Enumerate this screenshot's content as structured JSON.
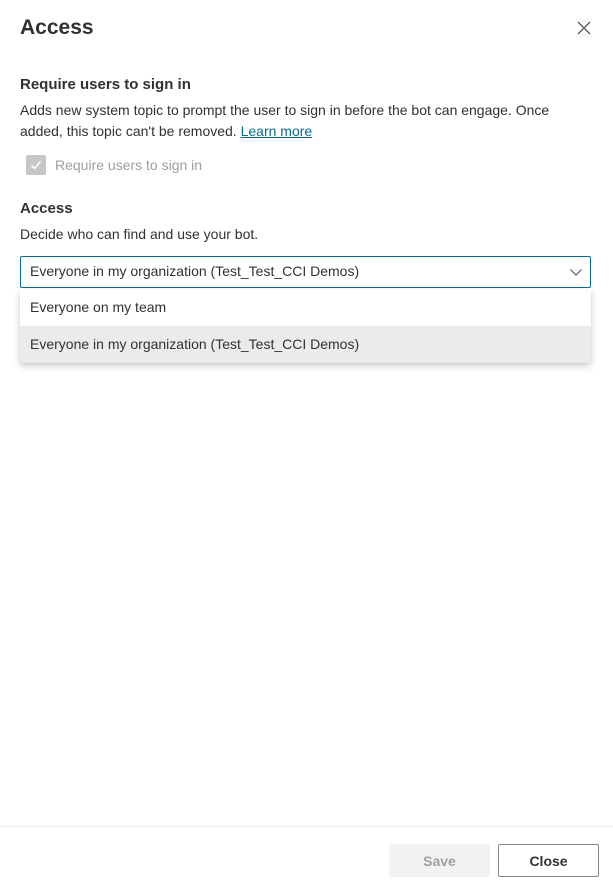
{
  "panel": {
    "title": "Access",
    "close_icon": "close-icon"
  },
  "signin": {
    "heading": "Require users to sign in",
    "description": "Adds new system topic to prompt the user to sign in before the bot can engage. Once added, this topic can't be removed.",
    "learn_more": "Learn more",
    "checkbox_label": "Require users to sign in",
    "checkbox_checked": true,
    "checkbox_disabled": true
  },
  "access": {
    "heading": "Access",
    "description": "Decide who can find and use your bot.",
    "selected_value": "Everyone in my organization (Test_Test_CCI Demos)",
    "options": [
      "Everyone on my team",
      "Everyone in my organization (Test_Test_CCI Demos)"
    ],
    "selected_index": 1
  },
  "footer": {
    "save_label": "Save",
    "close_label": "Close"
  },
  "colors": {
    "accent": "#0b6a8e",
    "text": "#323130",
    "disabled_text": "#a19f9d",
    "selected_option_bg": "#edebe9"
  }
}
